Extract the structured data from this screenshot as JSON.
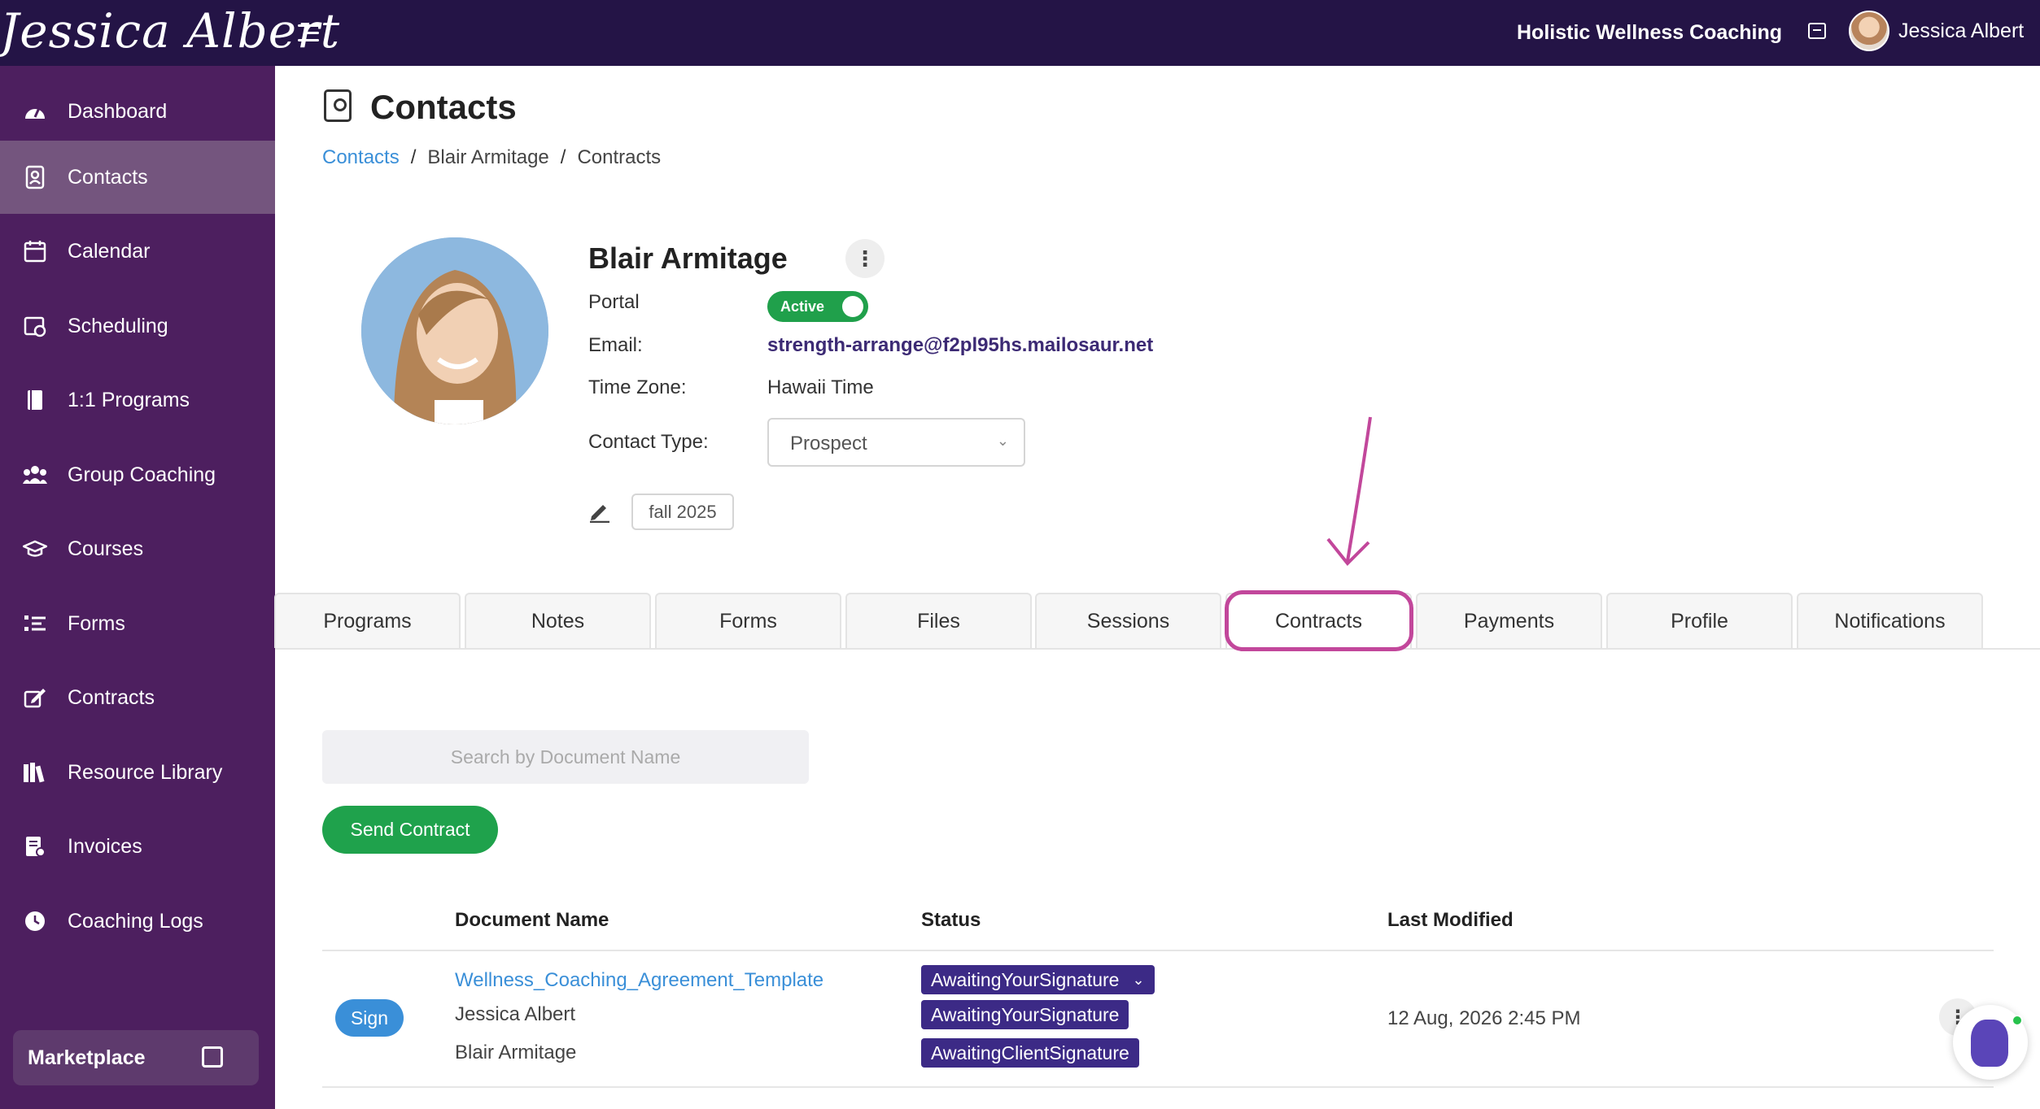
{
  "header": {
    "logo_text": "Jessica Albert",
    "business_name": "Holistic Wellness Coaching",
    "user_name": "Jessica Albert"
  },
  "sidebar": {
    "items": [
      {
        "label": "Dashboard",
        "icon": "dashboard-icon"
      },
      {
        "label": "Contacts",
        "icon": "contacts-icon",
        "active": true
      },
      {
        "label": "Calendar",
        "icon": "calendar-icon"
      },
      {
        "label": "Scheduling",
        "icon": "scheduling-icon"
      },
      {
        "label": "1:1 Programs",
        "icon": "book-icon"
      },
      {
        "label": "Group Coaching",
        "icon": "group-icon"
      },
      {
        "label": "Courses",
        "icon": "graduation-cap-icon"
      },
      {
        "label": "Forms",
        "icon": "list-icon"
      },
      {
        "label": "Contracts",
        "icon": "signature-icon"
      },
      {
        "label": "Resource Library",
        "icon": "library-icon"
      },
      {
        "label": "Invoices",
        "icon": "invoice-icon"
      },
      {
        "label": "Coaching Logs",
        "icon": "clock-icon"
      }
    ],
    "marketplace_label": "Marketplace"
  },
  "page": {
    "title": "Contacts",
    "breadcrumb": [
      "Contacts",
      "Blair Armitage",
      "Contracts"
    ]
  },
  "contact": {
    "name": "Blair Armitage",
    "portal_label": "Portal",
    "portal_status": "Active",
    "email_label": "Email:",
    "email": "strength-arrange@f2pl95hs.mailosaur.net",
    "timezone_label": "Time Zone:",
    "timezone": "Hawaii Time",
    "contact_type_label": "Contact Type:",
    "contact_type": "Prospect",
    "tag": "fall 2025"
  },
  "tabs": [
    "Programs",
    "Notes",
    "Forms",
    "Files",
    "Sessions",
    "Contracts",
    "Payments",
    "Profile",
    "Notifications"
  ],
  "active_tab": "Contracts",
  "contracts": {
    "search_placeholder": "Search by Document Name",
    "send_button": "Send Contract",
    "columns": [
      "Document Name",
      "Status",
      "Last Modified"
    ],
    "rows": [
      {
        "action": "Sign",
        "document_name": "Wellness_Coaching_Agreement_Template",
        "signers": [
          "Jessica Albert",
          "Blair Armitage"
        ],
        "status_main": "AwaitingYourSignature",
        "status_signers": [
          "AwaitingYourSignature",
          "AwaitingClientSignature"
        ],
        "last_modified": "12 Aug, 2026 2:45 PM"
      }
    ]
  },
  "colors": {
    "topbar": "#241446",
    "sidebar": "#4d1f5f",
    "accent_green": "#1fa24c",
    "link_blue": "#3a8fd8",
    "status_purple": "#3c2a86",
    "annotation_pink": "#c2479b"
  }
}
